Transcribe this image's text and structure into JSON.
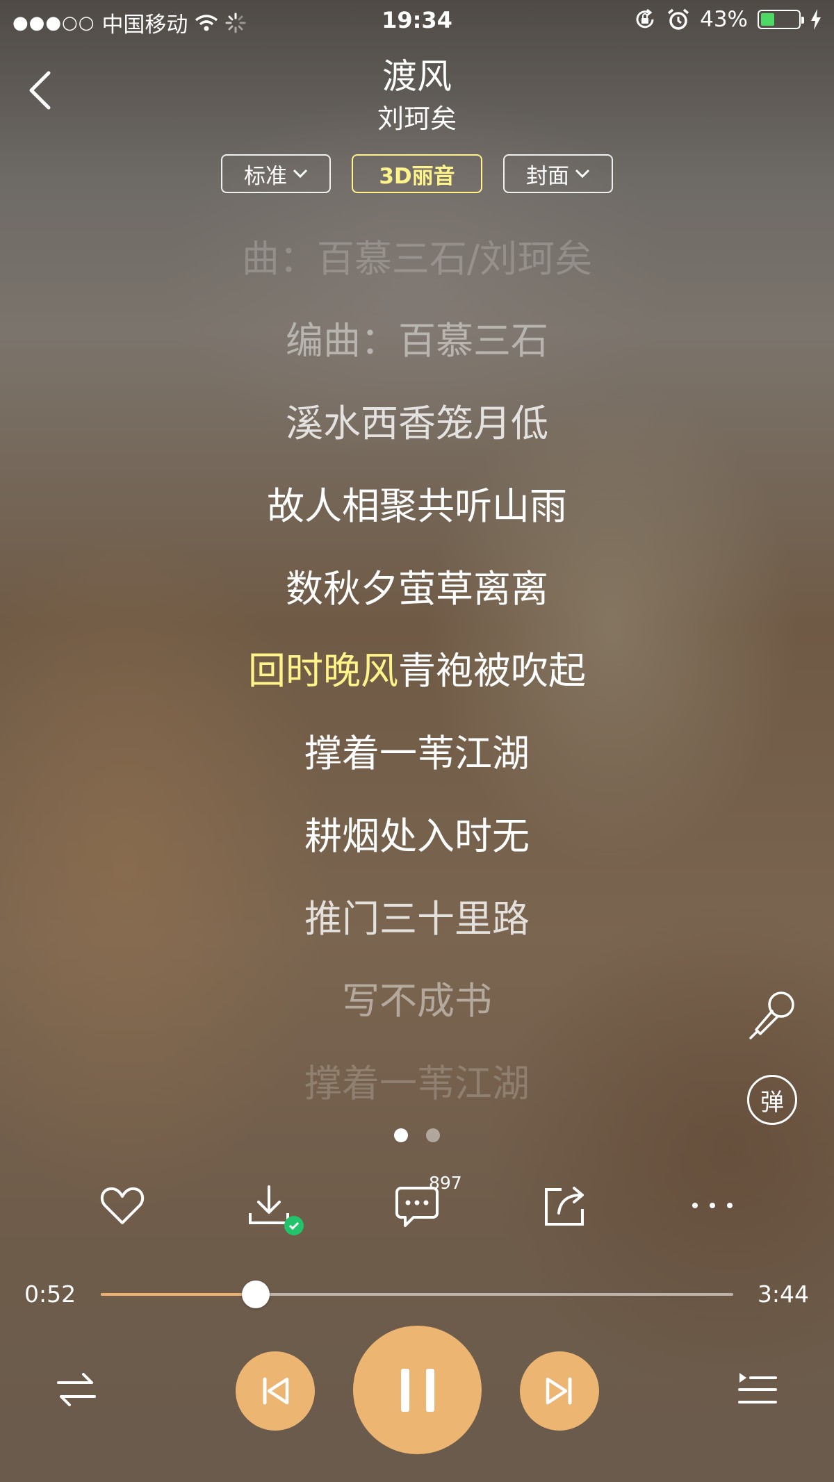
{
  "status_bar": {
    "signal": "●●●○○",
    "carrier": "中国移动",
    "time": "19:34",
    "battery": "43%",
    "battery_level": 0.43,
    "battery_color": "#4cd964"
  },
  "song": {
    "title": "渡风",
    "artist": "刘珂矣"
  },
  "tabs": [
    {
      "label": "标准",
      "dropdown": true
    },
    {
      "label": "3D丽音",
      "active": true
    },
    {
      "label": "封面",
      "dropdown": true
    }
  ],
  "lyrics": [
    {
      "text": "曲：百慕三石/刘珂矣",
      "style": "faint"
    },
    {
      "text": "编曲：百慕三石",
      "style": "dim"
    },
    {
      "text": "溪水西香笼月低",
      "style": "mid"
    },
    {
      "text": "故人相聚共听山雨",
      "style": "normal"
    },
    {
      "text": "数秋夕萤草离离",
      "style": "normal"
    },
    {
      "text_highlight": "回时晚风",
      "text_rest": "青袍被吹起",
      "style": "current"
    },
    {
      "text": "撑着一苇江湖",
      "style": "normal"
    },
    {
      "text": "耕烟处入时无",
      "style": "normal"
    },
    {
      "text": "推门三十里路",
      "style": "mid"
    },
    {
      "text": "写不成书",
      "style": "dim"
    },
    {
      "text": "撑着一苇江湖",
      "style": "faint"
    }
  ],
  "side": {
    "mic_icon": "microphone-icon",
    "danmu_label": "弹"
  },
  "actions": {
    "comment_count": "897",
    "icons": [
      "heart-icon",
      "download-icon",
      "comment-icon",
      "share-icon",
      "more-icon"
    ]
  },
  "progress": {
    "current": "0:52",
    "total": "3:44",
    "fraction": 0.245
  },
  "colors": {
    "accent": "#ecb672",
    "highlight": "#fff48a",
    "progress_fill": "#f0b070"
  }
}
